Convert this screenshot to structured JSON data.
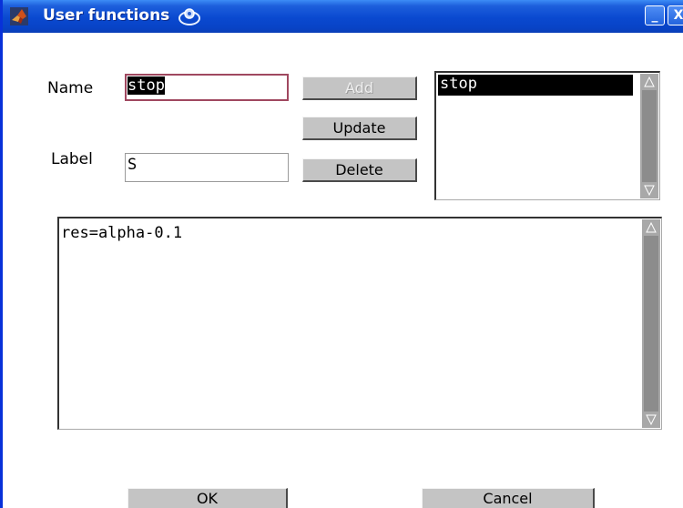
{
  "window": {
    "title": "User functions",
    "minimize_label": "_",
    "close_label": "X"
  },
  "form": {
    "name_label": "Name",
    "name_value": "stop",
    "label_label": "Label",
    "label_value": "S",
    "add_label": "Add",
    "update_label": "Update",
    "delete_label": "Delete"
  },
  "function_list": {
    "items": [
      "stop"
    ],
    "selected": "stop"
  },
  "editor": {
    "content": "res=alpha-0.1"
  },
  "footer": {
    "ok_label": "OK",
    "cancel_label": "Cancel"
  },
  "icons": {
    "app": "matlab-logo-icon",
    "title_decoration": "spiral-icon",
    "scroll_up": "arrow-up-icon",
    "scroll_down": "arrow-down-icon"
  },
  "colors": {
    "titlebar": "#0a49d0",
    "focused_border": "#a04860",
    "selection": "#000000",
    "button_face": "#c4c4c4"
  }
}
